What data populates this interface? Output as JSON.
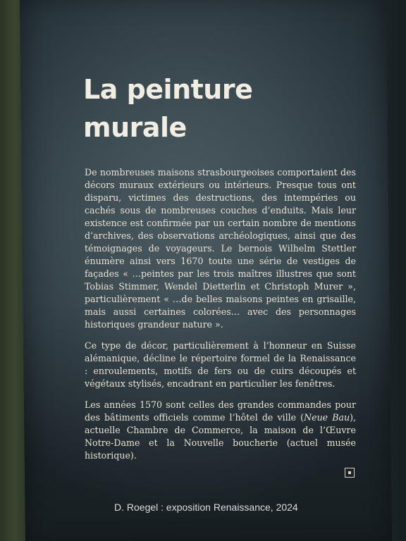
{
  "panel": {
    "title_line1": "La peinture",
    "title_line2": "murale",
    "p1": "De nombreuses maisons strasbourgeoises comportaient des décors muraux extérieurs ou intérieurs. Presque tous ont disparu, victimes des destructions, des intempéries ou cachés sous de nombreuses couches d’enduits. Mais leur existence est confirmée par un certain nombre de mentions d’archives, des observations archéologiques, ainsi que des témoignages de voyageurs. Le bernois Wilhelm Stettler énumère ainsi vers 1670 toute une série de vestiges de façades « …peintes par les trois maîtres illustres que sont Tobias Stimmer, Wendel Dietterlin et Christoph Murer », particulièrement « …de belles maisons peintes en grisaille, mais aussi certaines colorées… avec des personnages historiques grandeur nature ».",
    "p2": "Ce type de décor, particulièrement à l’honneur en Suisse alémanique, décline le répertoire formel de la Renaissance : enroulements, motifs de fers ou de cuirs découpés et végétaux stylisés, encadrant en particulier les fenêtres.",
    "p3_before": "Les années 1570 sont celles des grandes commandes pour des bâtiments officiels comme l’hôtel de ville (",
    "p3_italic": "Neue Bau",
    "p3_after": "), actuelle Chambre de Commerce, la maison de l’Œuvre Notre-Dame et la Nouvelle boucherie (actuel musée historique)."
  },
  "credit": "D. Roegel : exposition Renaissance, 2024",
  "colors": {
    "panel": "#3c4a52",
    "text": "#e9e2d3",
    "title": "#f2ede2"
  },
  "icons": {
    "page_mark": "square-outline-icon"
  }
}
